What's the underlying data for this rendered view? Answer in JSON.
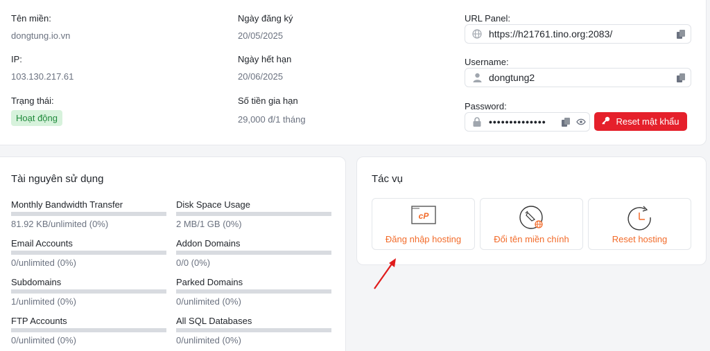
{
  "info": {
    "domain_label": "Tên miền:",
    "domain_value": "dongtung.io.vn",
    "ip_label": "IP:",
    "ip_value": "103.130.217.61",
    "status_label": "Trạng thái:",
    "status_value": "Hoạt động",
    "reg_label": "Ngày đăng ký",
    "reg_value": "20/05/2025",
    "exp_label": "Ngày hết hạn",
    "exp_value": "20/06/2025",
    "renew_label": "Số tiền gia hạn",
    "renew_value": "29,000 đ/1 tháng",
    "url_label": "URL Panel:",
    "url_value": "https://h21761.tino.org:2083/",
    "user_label": "Username:",
    "user_value": "dongtung2",
    "pass_label": "Password:",
    "pass_value": "••••••••••••••",
    "reset_label": "Reset mật khẩu"
  },
  "resources": {
    "title": "Tài nguyên sử dụng",
    "items": [
      {
        "label": "Monthly Bandwidth Transfer",
        "value": "81.92 KB/unlimited (0%)",
        "percent": 0
      },
      {
        "label": "Disk Space Usage",
        "value": "2 MB/1 GB (0%)",
        "percent": 0
      },
      {
        "label": "Email Accounts",
        "value": "0/unlimited (0%)",
        "percent": 0
      },
      {
        "label": "Addon Domains",
        "value": "0/0 (0%)",
        "percent": 0
      },
      {
        "label": "Subdomains",
        "value": "1/unlimited (0%)",
        "percent": 0
      },
      {
        "label": "Parked Domains",
        "value": "0/unlimited (0%)",
        "percent": 0
      },
      {
        "label": "FTP Accounts",
        "value": "0/unlimited (0%)",
        "percent": 0
      },
      {
        "label": "All SQL Databases",
        "value": "0/unlimited (0%)",
        "percent": 0
      }
    ]
  },
  "tasks": {
    "title": "Tác vụ",
    "items": [
      {
        "label": "Đăng nhập hosting",
        "icon": "cpanel-icon"
      },
      {
        "label": "Đổi tên miền chính",
        "icon": "rename-domain-icon"
      },
      {
        "label": "Reset hosting",
        "icon": "reset-clock-icon"
      }
    ]
  },
  "colors": {
    "accent": "#f26b2a",
    "danger": "#e5202b",
    "success_bg": "#d7f2dc",
    "success_text": "#1f8a3b",
    "annotation_arrow": "#e01b1b"
  }
}
